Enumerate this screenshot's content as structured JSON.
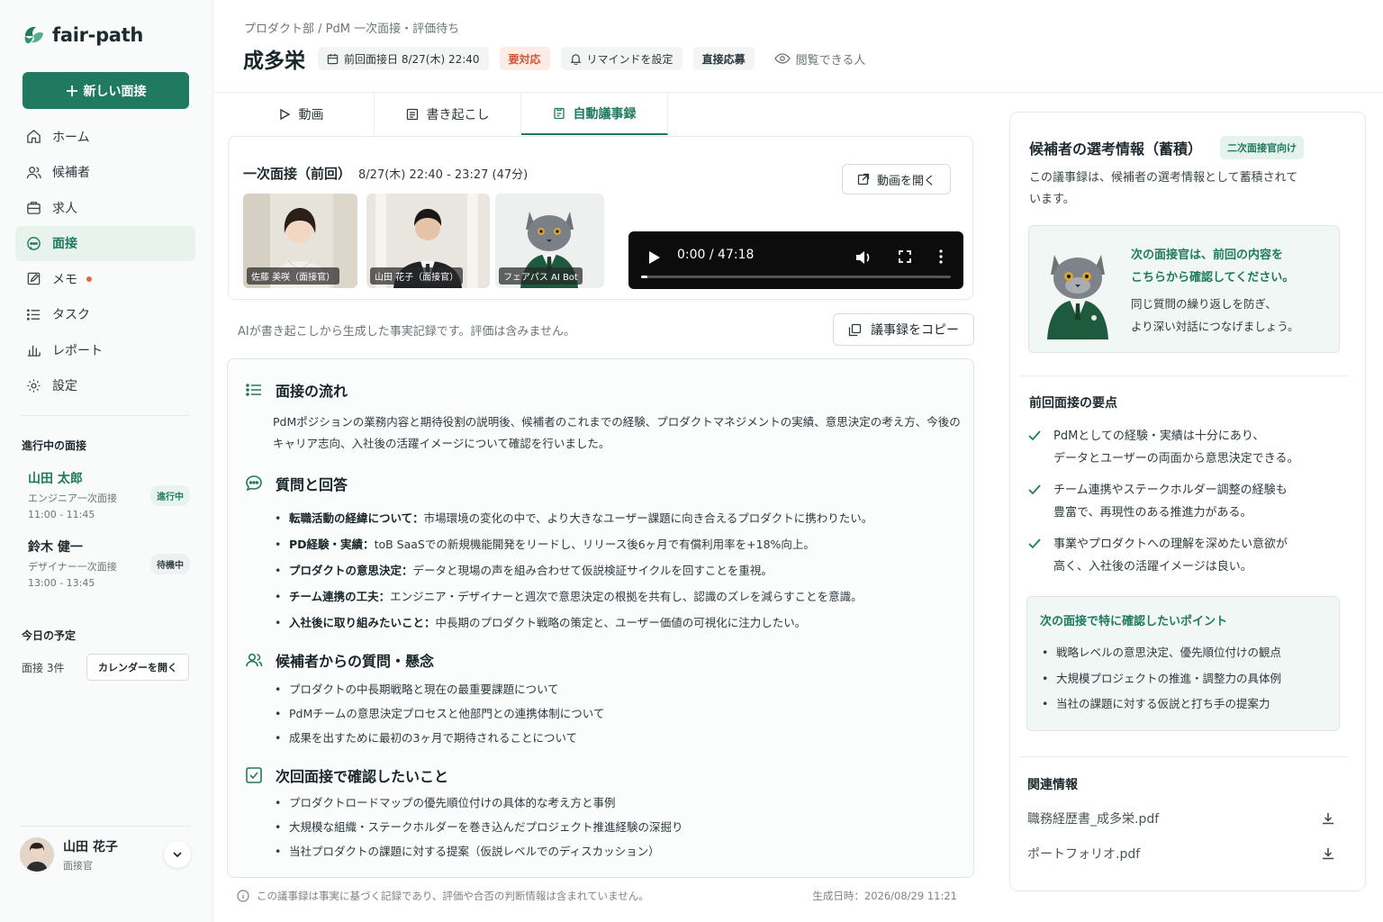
{
  "app": {
    "name": "fair-path",
    "brand_color": "#1f7a5f"
  },
  "sidebar": {
    "new_button": "新しい面接",
    "nav": [
      {
        "label": "ホーム",
        "icon": "home-icon"
      },
      {
        "label": "候補者",
        "icon": "users-icon"
      },
      {
        "label": "求人",
        "icon": "briefcase-icon"
      },
      {
        "label": "面接",
        "icon": "chat-icon",
        "active": true
      },
      {
        "label": "メモ",
        "icon": "note-icon",
        "dot": true
      },
      {
        "label": "タスク",
        "icon": "list-icon"
      },
      {
        "label": "レポート",
        "icon": "bar-chart-icon"
      },
      {
        "label": "設定",
        "icon": "gear-icon"
      }
    ],
    "in_progress_heading": "進行中の面接",
    "in_progress": [
      {
        "name": "山田 太郎",
        "role": "エンジニア一次面接",
        "time": "11:00 - 11:45",
        "status": "進行中"
      },
      {
        "name": "鈴木 健一",
        "role": "デザイナー一次面接",
        "time": "13:00 - 13:45",
        "status": "待機中"
      }
    ],
    "today_heading": "今日の予定",
    "today_count": "面接 3件",
    "calendar_button": "カレンダーを開く",
    "user": {
      "name": "山田 花子",
      "role": "面接官"
    }
  },
  "header": {
    "breadcrumb": "プロダクト部 / PdM 一次面接・評価待ち",
    "title": "成多栄",
    "last_interview": "前回面接日 8/27(木) 22:40",
    "status_badge": "要対応",
    "remind": "リマインドを設定",
    "apply_type": "直接応募",
    "viewers": "閲覧できる人"
  },
  "tabs": [
    {
      "label": "動画",
      "icon": "play-icon"
    },
    {
      "label": "書き起こし",
      "icon": "transcript-icon"
    },
    {
      "label": "自動議事録",
      "icon": "minutes-icon",
      "active": true
    }
  ],
  "meeting": {
    "title": "一次面接（前回）",
    "time": "8/27(木) 22:40 - 23:27 (47分)",
    "open_video": "動画を開く",
    "participants": [
      {
        "label": "佐藤 美咲（面接官）"
      },
      {
        "label": "山田 花子（面接官）"
      },
      {
        "label": "フェアパス AI Bot"
      }
    ],
    "player": {
      "time": "0:00 / 47:18",
      "progress": 0.02
    }
  },
  "minutes": {
    "disclaimer": "AIが書き起こしから生成した事実記録です。評価は含みません。",
    "copy_button": "議事録をコピー",
    "flow": {
      "heading": "面接の流れ",
      "text": "PdMポジションの業務内容と期待役割の説明後、候補者のこれまでの経験、プロダクトマネジメントの実績、意思決定の考え方、今後のキャリア志向、入社後の活躍イメージについて確認を行いました。"
    },
    "qa": {
      "heading": "質問と回答",
      "items": [
        {
          "key": "転職活動の経緯について",
          "value": "市場環境の変化の中で、より大きなユーザー課題に向き合えるプロダクトに携わりたい。"
        },
        {
          "key": "PD経験・実績",
          "value": "toB SaaSでの新規機能開発をリードし、リリース後6ヶ月で有償利用率を+18%向上。"
        },
        {
          "key": "プロダクトの意思決定",
          "value": "データと現場の声を組み合わせて仮説検証サイクルを回すことを重視。"
        },
        {
          "key": "チーム連携の工夫",
          "value": "エンジニア・デザイナーと週次で意思決定の根拠を共有し、認識のズレを減らすことを意識。"
        },
        {
          "key": "入社後に取り組みたいこと",
          "value": "中長期のプロダクト戦略の策定と、ユーザー価値の可視化に注力したい。"
        }
      ]
    },
    "concerns": {
      "heading": "候補者からの質問・懸念",
      "items": [
        "プロダクトの中長期戦略と現在の最重要課題について",
        "PdMチームの意思決定プロセスと他部門との連携体制について",
        "成果を出すために最初の3ヶ月で期待されることについて"
      ]
    },
    "next": {
      "heading": "次回面接で確認したいこと",
      "items": [
        "プロダクトロードマップの優先順位付けの具体的な考え方と事例",
        "大規模な組織・ステークホルダーを巻き込んだプロジェクト推進経験の深掘り",
        "当社プロダクトの課題に対する提案（仮説レベルでのディスカッション）"
      ]
    },
    "footer_note": "この議事録は事実に基づく記録であり、評価や合否の判断情報は含まれていません。",
    "generated_at": "生成日時：2026/08/29 11:21"
  },
  "right_panel": {
    "title": "候補者の選考情報（蓄積）",
    "badge": "二次面接官向け",
    "desc": "この議事録は、候補者の選考情報として蓄積されています。",
    "callout_main": [
      "次の面接官は、前回の内容を",
      "こちらから確認してください。"
    ],
    "callout_sub": [
      "同じ質問の繰り返しを防ぎ、",
      "より深い対話につなげましょう。"
    ],
    "summary_heading": "前回面接の要点",
    "summary": [
      [
        "PdMとしての経験・実績は十分にあり、",
        "データとユーザーの両面から意思決定できる。"
      ],
      [
        "チーム連携やステークホルダー調整の経験も",
        "豊富で、再現性のある推進力がある。"
      ],
      [
        "事業やプロダクトへの理解を深めたい意欲が",
        "高く、入社後の活躍イメージは良い。"
      ]
    ],
    "focus_heading": "次の面接で特に確認したいポイント",
    "focus": [
      "戦略レベルの意思決定、優先順位付けの観点",
      "大規模プロジェクトの推進・調整力の具体例",
      "当社の課題に対する仮説と打ち手の提案力"
    ],
    "related_heading": "関連情報",
    "files": [
      "職務経歴書_成多栄.pdf",
      "ポートフォリオ.pdf"
    ]
  }
}
